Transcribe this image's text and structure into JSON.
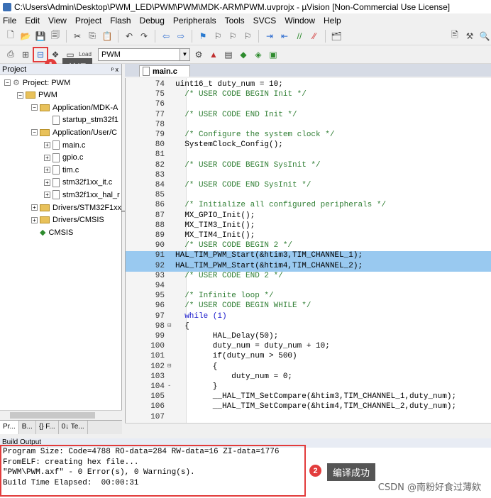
{
  "window": {
    "title": "C:\\Users\\Admin\\Desktop\\PWM_LED\\PWM\\PWM\\MDK-ARM\\PWM.uvprojx - µVision  [Non-Commercial Use License]"
  },
  "menu": [
    "File",
    "Edit",
    "View",
    "Project",
    "Flash",
    "Debug",
    "Peripherals",
    "Tools",
    "SVCS",
    "Window",
    "Help"
  ],
  "toolbar2": {
    "target": "PWM"
  },
  "annotations": {
    "build_num": "1",
    "build_label": "编译",
    "success_num": "2",
    "success_label": "编译成功",
    "accent": "#e23c3c"
  },
  "project": {
    "header": "Project",
    "pin": "ᵖ x",
    "tree": [
      {
        "label": "Project: PWM",
        "level": 0,
        "kind": "root",
        "exp": "−"
      },
      {
        "label": "PWM",
        "level": 1,
        "kind": "target",
        "exp": "−"
      },
      {
        "label": "Application/MDK-A",
        "level": 2,
        "kind": "folder",
        "exp": "−"
      },
      {
        "label": "startup_stm32f1",
        "level": 3,
        "kind": "file",
        "exp": ""
      },
      {
        "label": "Application/User/C",
        "level": 2,
        "kind": "folder",
        "exp": "−"
      },
      {
        "label": "main.c",
        "level": 3,
        "kind": "file",
        "exp": "+"
      },
      {
        "label": "gpio.c",
        "level": 3,
        "kind": "file",
        "exp": "+"
      },
      {
        "label": "tim.c",
        "level": 3,
        "kind": "file",
        "exp": "+"
      },
      {
        "label": "stm32f1xx_it.c",
        "level": 3,
        "kind": "file",
        "exp": "+"
      },
      {
        "label": "stm32f1xx_hal_r",
        "level": 3,
        "kind": "file",
        "exp": "+"
      },
      {
        "label": "Drivers/STM32F1xx_",
        "level": 2,
        "kind": "folder",
        "exp": "+"
      },
      {
        "label": "Drivers/CMSIS",
        "level": 2,
        "kind": "folder",
        "exp": "+"
      },
      {
        "label": "CMSIS",
        "level": 2,
        "kind": "gem",
        "exp": ""
      }
    ],
    "tabs": [
      "Pr...",
      "B...",
      "{} F...",
      "0↓ Te..."
    ]
  },
  "editor": {
    "tab": "main.c",
    "lines": [
      {
        "n": "74",
        "fold": "",
        "code": "uint16_t duty_num = 10;",
        "cls": ""
      },
      {
        "n": "75",
        "fold": "",
        "code": "  /* USER CODE BEGIN Init */",
        "cls": "c-comment"
      },
      {
        "n": "76",
        "fold": "",
        "code": "",
        "cls": ""
      },
      {
        "n": "77",
        "fold": "",
        "code": "  /* USER CODE END Init */",
        "cls": "c-comment"
      },
      {
        "n": "78",
        "fold": "",
        "code": "",
        "cls": ""
      },
      {
        "n": "79",
        "fold": "",
        "code": "  /* Configure the system clock */",
        "cls": "c-comment"
      },
      {
        "n": "80",
        "fold": "",
        "code": "  SystemClock_Config();",
        "cls": ""
      },
      {
        "n": "81",
        "fold": "",
        "code": "",
        "cls": ""
      },
      {
        "n": "82",
        "fold": "",
        "code": "  /* USER CODE BEGIN SysInit */",
        "cls": "c-comment"
      },
      {
        "n": "83",
        "fold": "",
        "code": "",
        "cls": ""
      },
      {
        "n": "84",
        "fold": "",
        "code": "  /* USER CODE END SysInit */",
        "cls": "c-comment"
      },
      {
        "n": "85",
        "fold": "",
        "code": "",
        "cls": ""
      },
      {
        "n": "86",
        "fold": "",
        "code": "  /* Initialize all configured peripherals */",
        "cls": "c-comment"
      },
      {
        "n": "87",
        "fold": "",
        "code": "  MX_GPIO_Init();",
        "cls": ""
      },
      {
        "n": "88",
        "fold": "",
        "code": "  MX_TIM3_Init();",
        "cls": ""
      },
      {
        "n": "89",
        "fold": "",
        "code": "  MX_TIM4_Init();",
        "cls": ""
      },
      {
        "n": "90",
        "fold": "",
        "code": "  /* USER CODE BEGIN 2 */",
        "cls": "c-comment"
      },
      {
        "n": "91",
        "fold": "",
        "code": "HAL_TIM_PWM_Start(&htim3,TIM_CHANNEL_1);",
        "cls": "hlrow"
      },
      {
        "n": "92",
        "fold": "",
        "code": "HAL_TIM_PWM_Start(&htim4,TIM_CHANNEL_2);",
        "cls": "hlrow"
      },
      {
        "n": "93",
        "fold": "",
        "code": "  /* USER CODE END 2 */",
        "cls": "c-comment"
      },
      {
        "n": "94",
        "fold": "",
        "code": "",
        "cls": ""
      },
      {
        "n": "95",
        "fold": "",
        "code": "  /* Infinite loop */",
        "cls": "c-comment"
      },
      {
        "n": "96",
        "fold": "",
        "code": "  /* USER CODE BEGIN WHILE */",
        "cls": "c-comment"
      },
      {
        "n": "97",
        "fold": "",
        "code": "  while (1)",
        "cls": "c-kw"
      },
      {
        "n": "98",
        "fold": "⊟",
        "code": "  {",
        "cls": ""
      },
      {
        "n": "99",
        "fold": "",
        "code": "        HAL_Delay(50);",
        "cls": ""
      },
      {
        "n": "100",
        "fold": "",
        "code": "        duty_num = duty_num + 10;",
        "cls": ""
      },
      {
        "n": "101",
        "fold": "",
        "code": "        if(duty_num > 500)",
        "cls": ""
      },
      {
        "n": "102",
        "fold": "⊟",
        "code": "        {",
        "cls": ""
      },
      {
        "n": "103",
        "fold": "",
        "code": "            duty_num = 0;",
        "cls": ""
      },
      {
        "n": "104",
        "fold": "-",
        "code": "        }",
        "cls": ""
      },
      {
        "n": "105",
        "fold": "",
        "code": "        __HAL_TIM_SetCompare(&htim3,TIM_CHANNEL_1,duty_num);",
        "cls": ""
      },
      {
        "n": "106",
        "fold": "",
        "code": "        __HAL_TIM_SetCompare(&htim4,TIM_CHANNEL_2,duty_num);",
        "cls": ""
      },
      {
        "n": "107",
        "fold": "",
        "code": "",
        "cls": ""
      }
    ]
  },
  "build": {
    "header": "Build Output",
    "lines": [
      "Program Size: Code=4788 RO-data=284 RW-data=16 ZI-data=1776",
      "FromELF: creating hex file...",
      "\"PWM\\PWM.axf\" - 0 Error(s), 0 Warning(s).",
      "Build Time Elapsed:  00:00:31"
    ]
  },
  "watermark": "CSDN @南粉好食过薄欸"
}
